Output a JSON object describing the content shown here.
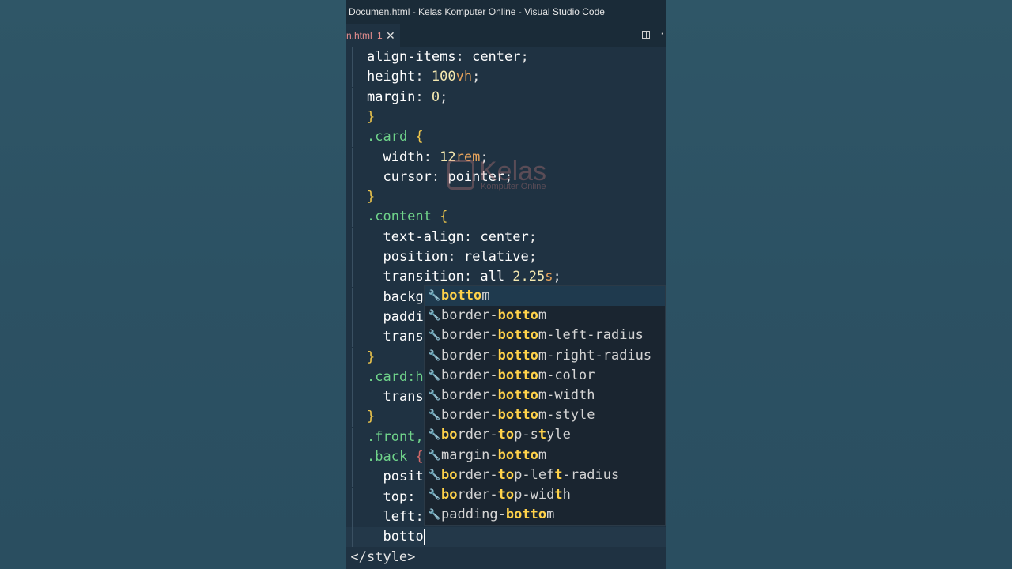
{
  "window": {
    "title": "Documen.html - Kelas Komputer Online - Visual Studio Code"
  },
  "tab": {
    "name": "n.html",
    "badge": "1",
    "close": "✕"
  },
  "editor": {
    "lines": [
      {
        "t1": "align-items",
        "t2": ": ",
        "t3": "center",
        "t4": ";"
      },
      {
        "t1": "height",
        "t2": ": ",
        "n": "100",
        "u": "vh",
        "t4": ";"
      },
      {
        "t1": "margin",
        "t2": ": ",
        "n": "0",
        "t4": ";"
      },
      {
        "b": "}"
      },
      {
        "s": ".card",
        "b": " {"
      },
      {
        "t1": "width",
        "t2": ": ",
        "n": "12",
        "u": "rem",
        "t4": ";"
      },
      {
        "t1": "cursor",
        "t2": ": ",
        "t3": "pointer",
        "t4": ";"
      },
      {
        "b": "}"
      },
      {
        "s": ".content",
        "b": " {"
      },
      {
        "t1": "text-align",
        "t2": ": ",
        "t3": "center",
        "t4": ";"
      },
      {
        "t1": "position",
        "t2": ": ",
        "t3": "relative",
        "t4": ";"
      },
      {
        "t1": "transition",
        "t2": ": ",
        "t3": "all ",
        "n": "2.25",
        "u": "s",
        "t4": ";"
      },
      {
        "t1": "backg"
      },
      {
        "t1": "paddi"
      },
      {
        "t1": "trans"
      },
      {
        "b": "}"
      },
      {
        "s": ".card:h"
      },
      {
        "t1": "trans"
      },
      {
        "b": "}"
      },
      {
        "s": ".front,"
      },
      {
        "s": ".back",
        "b2": " {"
      },
      {
        "t1": "posit"
      },
      {
        "t1": "top:"
      },
      {
        "t1": "left:"
      },
      {
        "t1": "botto"
      },
      {
        "tag": "</style>"
      }
    ]
  },
  "suggestions": [
    {
      "pre": "",
      "hl": "botto",
      "post": "m"
    },
    {
      "pre": "border-",
      "hl": "botto",
      "post": "m"
    },
    {
      "pre": "border-",
      "hl": "botto",
      "post": "m-left-radius"
    },
    {
      "pre": "border-",
      "hl": "botto",
      "post": "m-right-radius"
    },
    {
      "pre": "border-",
      "hl": "botto",
      "post": "m-color"
    },
    {
      "pre": "border-",
      "hl": "botto",
      "post": "m-width"
    },
    {
      "pre": "border-",
      "hl": "botto",
      "post": "m-style"
    },
    {
      "rich": [
        [
          "bo",
          1
        ],
        [
          "rder-",
          0
        ],
        [
          "to",
          1
        ],
        [
          "p-s",
          0
        ],
        [
          "t",
          1
        ],
        [
          "yle",
          0
        ]
      ]
    },
    {
      "pre": "margin-",
      "hl": "botto",
      "post": "m"
    },
    {
      "rich": [
        [
          "bo",
          1
        ],
        [
          "rder-",
          0
        ],
        [
          "to",
          1
        ],
        [
          "p-lef",
          0
        ],
        [
          "t",
          1
        ],
        [
          "-radius",
          0
        ]
      ]
    },
    {
      "rich": [
        [
          "bo",
          1
        ],
        [
          "rder-",
          0
        ],
        [
          "to",
          1
        ],
        [
          "p-wid",
          0
        ],
        [
          "t",
          1
        ],
        [
          "h",
          0
        ]
      ]
    },
    {
      "pre": "padding-",
      "hl": "botto",
      "post": "m"
    }
  ],
  "watermark": {
    "title": "Kelas",
    "subtitle": "Komputer Online"
  }
}
